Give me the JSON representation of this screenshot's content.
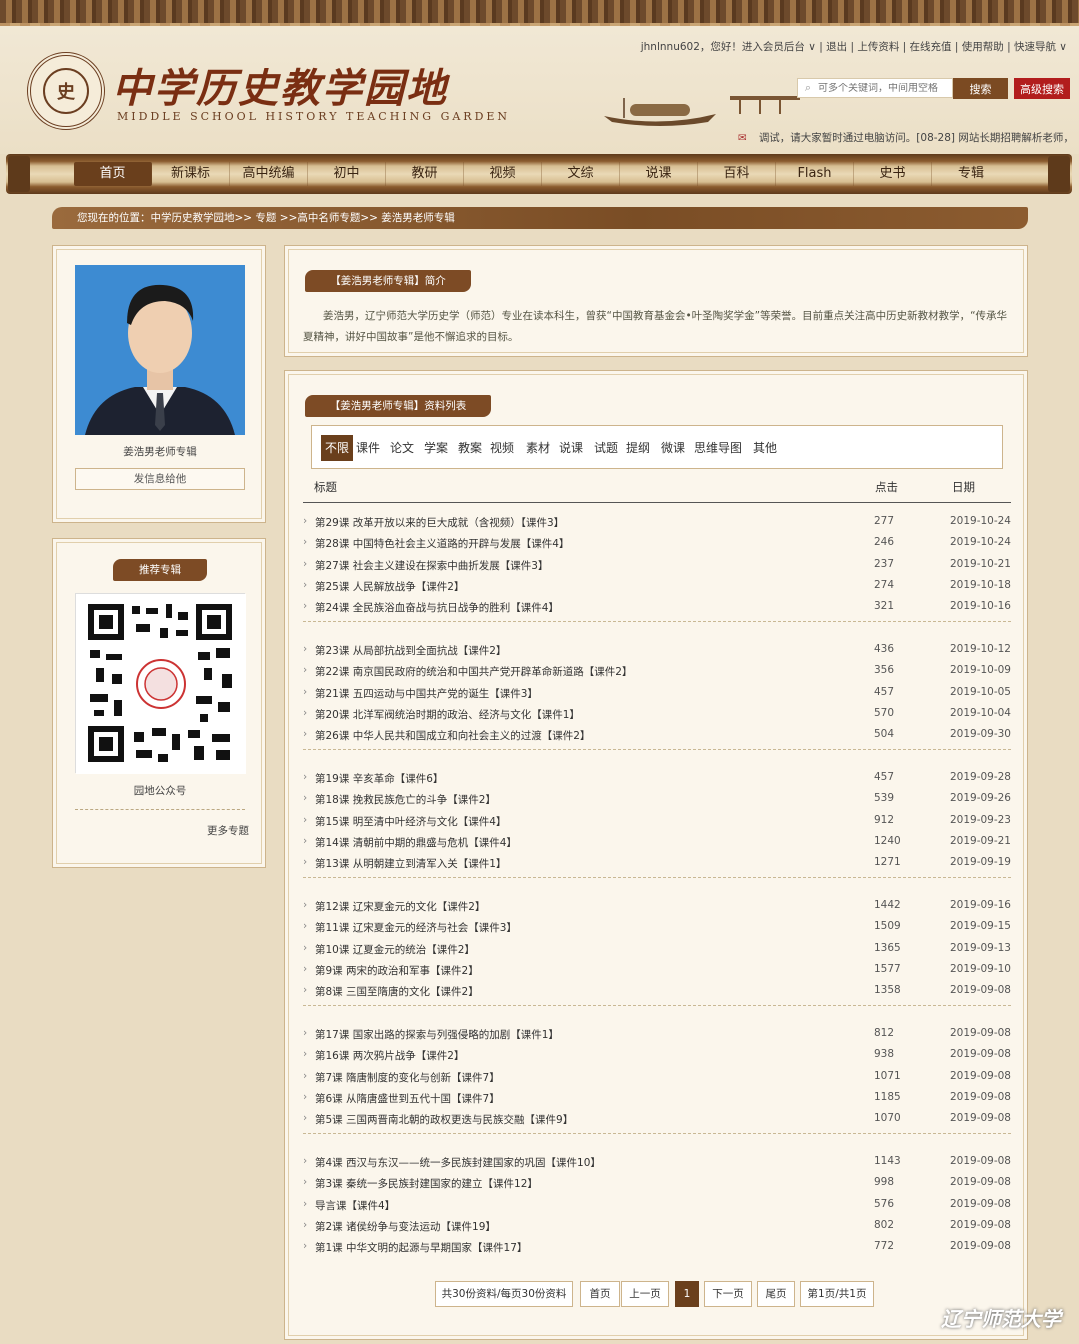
{
  "site": {
    "title": "中学历史教学园地",
    "subtitle": "MIDDLE SCHOOL HISTORY TEACHING GARDEN",
    "seal_text": "史"
  },
  "userbar": {
    "text": "jhnlnnu602，您好！进入会员后台 ∨ | 退出 | 上传资料 | 在线充值 | 使用帮助 | 快速导航 ∨"
  },
  "search": {
    "placeholder": "可多个关键词，中间用空格",
    "button": "搜索",
    "advanced": "高级搜索"
  },
  "notice": "调试，请大家暂时通过电脑访问。[08-28]    网站长期招聘解析老师，",
  "nav": [
    "首页",
    "新课标",
    "高中统编",
    "初中",
    "教研",
    "视频",
    "文综",
    "说课",
    "百科",
    "Flash",
    "史书",
    "专辑"
  ],
  "breadcrumb": "您现在的位置：中学历史教学园地>> 专题 >>高中名师专题>> 姜浩男老师专辑",
  "profile": {
    "name": "姜浩男老师专辑",
    "message_button": "发信息给他"
  },
  "recommend": {
    "title": "推荐专辑",
    "qr_caption": "园地公众号",
    "more": "更多专题"
  },
  "intro": {
    "title": "【姜浩男老师专辑】简介",
    "text": "姜浩男，辽宁师范大学历史学（师范）专业在读本科生，曾获“中国教育基金会•叶圣陶奖学金”等荣誉。目前重点关注高中历史新教材教学，“传承华夏精神，讲好中国故事”是他不懈追求的目标。"
  },
  "list": {
    "title": "【姜浩男老师专辑】资料列表",
    "filters": [
      "不限",
      "课件",
      "论文",
      "学案",
      "教案",
      "视频",
      "素材",
      "说课",
      "试题",
      "提纲",
      "微课",
      "思维导图",
      "其他"
    ],
    "headers": {
      "title": "标题",
      "clicks": "点击",
      "date": "日期"
    },
    "groups": [
      [
        {
          "title": "第29课 改革开放以来的巨大成就（含视频）【课件3】",
          "clicks": "277",
          "date": "2019-10-24"
        },
        {
          "title": "第28课 中国特色社会主义道路的开辟与发展【课件4】",
          "clicks": "246",
          "date": "2019-10-24"
        },
        {
          "title": "第27课 社会主义建设在探索中曲折发展【课件3】",
          "clicks": "237",
          "date": "2019-10-21"
        },
        {
          "title": "第25课 人民解放战争【课件2】",
          "clicks": "274",
          "date": "2019-10-18"
        },
        {
          "title": "第24课 全民族浴血奋战与抗日战争的胜利【课件4】",
          "clicks": "321",
          "date": "2019-10-16"
        }
      ],
      [
        {
          "title": "第23课 从局部抗战到全面抗战【课件2】",
          "clicks": "436",
          "date": "2019-10-12"
        },
        {
          "title": "第22课 南京国民政府的统治和中国共产党开辟革命新道路【课件2】",
          "clicks": "356",
          "date": "2019-10-09"
        },
        {
          "title": "第21课 五四运动与中国共产党的诞生【课件3】",
          "clicks": "457",
          "date": "2019-10-05"
        },
        {
          "title": "第20课 北洋军阀统治时期的政治、经济与文化【课件1】",
          "clicks": "570",
          "date": "2019-10-04"
        },
        {
          "title": "第26课 中华人民共和国成立和向社会主义的过渡【课件2】",
          "clicks": "504",
          "date": "2019-09-30"
        }
      ],
      [
        {
          "title": "第19课 辛亥革命【课件6】",
          "clicks": "457",
          "date": "2019-09-28"
        },
        {
          "title": "第18课 挽救民族危亡的斗争【课件2】",
          "clicks": "539",
          "date": "2019-09-26"
        },
        {
          "title": "第15课 明至清中叶经济与文化【课件4】",
          "clicks": "912",
          "date": "2019-09-23"
        },
        {
          "title": "第14课 清朝前中期的鼎盛与危机【课件4】",
          "clicks": "1240",
          "date": "2019-09-21"
        },
        {
          "title": "第13课 从明朝建立到清军入关【课件1】",
          "clicks": "1271",
          "date": "2019-09-19"
        }
      ],
      [
        {
          "title": "第12课 辽宋夏金元的文化【课件2】",
          "clicks": "1442",
          "date": "2019-09-16"
        },
        {
          "title": "第11课 辽宋夏金元的经济与社会【课件3】",
          "clicks": "1509",
          "date": "2019-09-15"
        },
        {
          "title": "第10课 辽夏金元的统治【课件2】",
          "clicks": "1365",
          "date": "2019-09-13"
        },
        {
          "title": "第9课 两宋的政治和军事【课件2】",
          "clicks": "1577",
          "date": "2019-09-10"
        },
        {
          "title": "第8课 三国至隋唐的文化【课件2】",
          "clicks": "1358",
          "date": "2019-09-08"
        }
      ],
      [
        {
          "title": "第17课 国家出路的探索与列强侵略的加剧【课件1】",
          "clicks": "812",
          "date": "2019-09-08"
        },
        {
          "title": "第16课 两次鸦片战争【课件2】",
          "clicks": "938",
          "date": "2019-09-08"
        },
        {
          "title": "第7课 隋唐制度的变化与创新【课件7】",
          "clicks": "1071",
          "date": "2019-09-08"
        },
        {
          "title": "第6课 从隋唐盛世到五代十国【课件7】",
          "clicks": "1185",
          "date": "2019-09-08"
        },
        {
          "title": "第5课 三国两晋南北朝的政权更迭与民族交融【课件9】",
          "clicks": "1070",
          "date": "2019-09-08"
        }
      ],
      [
        {
          "title": "第4课 西汉与东汉——统一多民族封建国家的巩固【课件10】",
          "clicks": "1143",
          "date": "2019-09-08"
        },
        {
          "title": "第3课 秦统一多民族封建国家的建立【课件12】",
          "clicks": "998",
          "date": "2019-09-08"
        },
        {
          "title": "导言课【课件4】",
          "clicks": "576",
          "date": "2019-09-08"
        },
        {
          "title": "第2课 诸侯纷争与变法运动【课件19】",
          "clicks": "802",
          "date": "2019-09-08"
        },
        {
          "title": "第1课 中华文明的起源与早期国家【课件17】",
          "clicks": "772",
          "date": "2019-09-08"
        }
      ]
    ],
    "pager": {
      "summary": "共30份资料/每页30份资料",
      "first": "首页",
      "prev": "上一页",
      "current": "1",
      "next": "下一页",
      "last": "尾页",
      "page_of": "第1页/共1页"
    }
  },
  "watermark": "辽宁师范大学"
}
